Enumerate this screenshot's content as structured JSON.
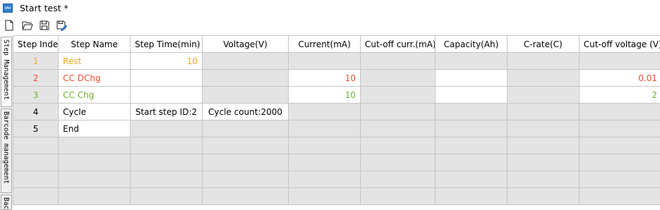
{
  "window": {
    "title": "Start test *",
    "app_icon_text": "ww"
  },
  "toolbar": {
    "buttons": [
      {
        "name": "new-file",
        "icon": "new-file-icon"
      },
      {
        "name": "open-folder",
        "icon": "folder-open-icon"
      },
      {
        "name": "save",
        "icon": "save-icon"
      },
      {
        "name": "save-as",
        "icon": "save-as-icon"
      }
    ]
  },
  "side_tabs": [
    {
      "label": "Step Management",
      "active": true
    },
    {
      "label": "Barcode management",
      "active": false
    },
    {
      "label": "Bac",
      "active": false
    }
  ],
  "table": {
    "columns": [
      "Step Index",
      "Step Name",
      "Step Time(min)",
      "Voltage(V)",
      "Current(mA)",
      "Cut-off curr.(mA)",
      "Capacity(Ah)",
      "C-rate(C)",
      "Cut-off voltage (V)"
    ],
    "rows": [
      {
        "index": "1",
        "name": "Rest",
        "time": "10",
        "voltage": "",
        "current": "",
        "cutoff_current": "",
        "capacity": "",
        "crate": "",
        "cutoff_voltage": "",
        "color": "#f0a81c"
      },
      {
        "index": "2",
        "name": "CC DChg",
        "time": "",
        "voltage": "",
        "current": "10",
        "cutoff_current": "",
        "capacity": "",
        "crate": "",
        "cutoff_voltage": "0.01",
        "color": "#e8502a"
      },
      {
        "index": "3",
        "name": "CC Chg",
        "time": "",
        "voltage": "",
        "current": "10",
        "cutoff_current": "",
        "capacity": "",
        "crate": "",
        "cutoff_voltage": "2",
        "color": "#6fb52c"
      },
      {
        "index": "4",
        "name": "Cycle",
        "time": "Start step ID:2",
        "voltage": "Cycle count:2000",
        "current": "",
        "cutoff_current": "",
        "capacity": "",
        "crate": "",
        "cutoff_voltage": "",
        "color": "#000000"
      },
      {
        "index": "5",
        "name": "End",
        "time": "",
        "voltage": "",
        "current": "",
        "cutoff_current": "",
        "capacity": "",
        "crate": "",
        "cutoff_voltage": "",
        "color": "#000000"
      }
    ],
    "empty_rows": 4
  }
}
